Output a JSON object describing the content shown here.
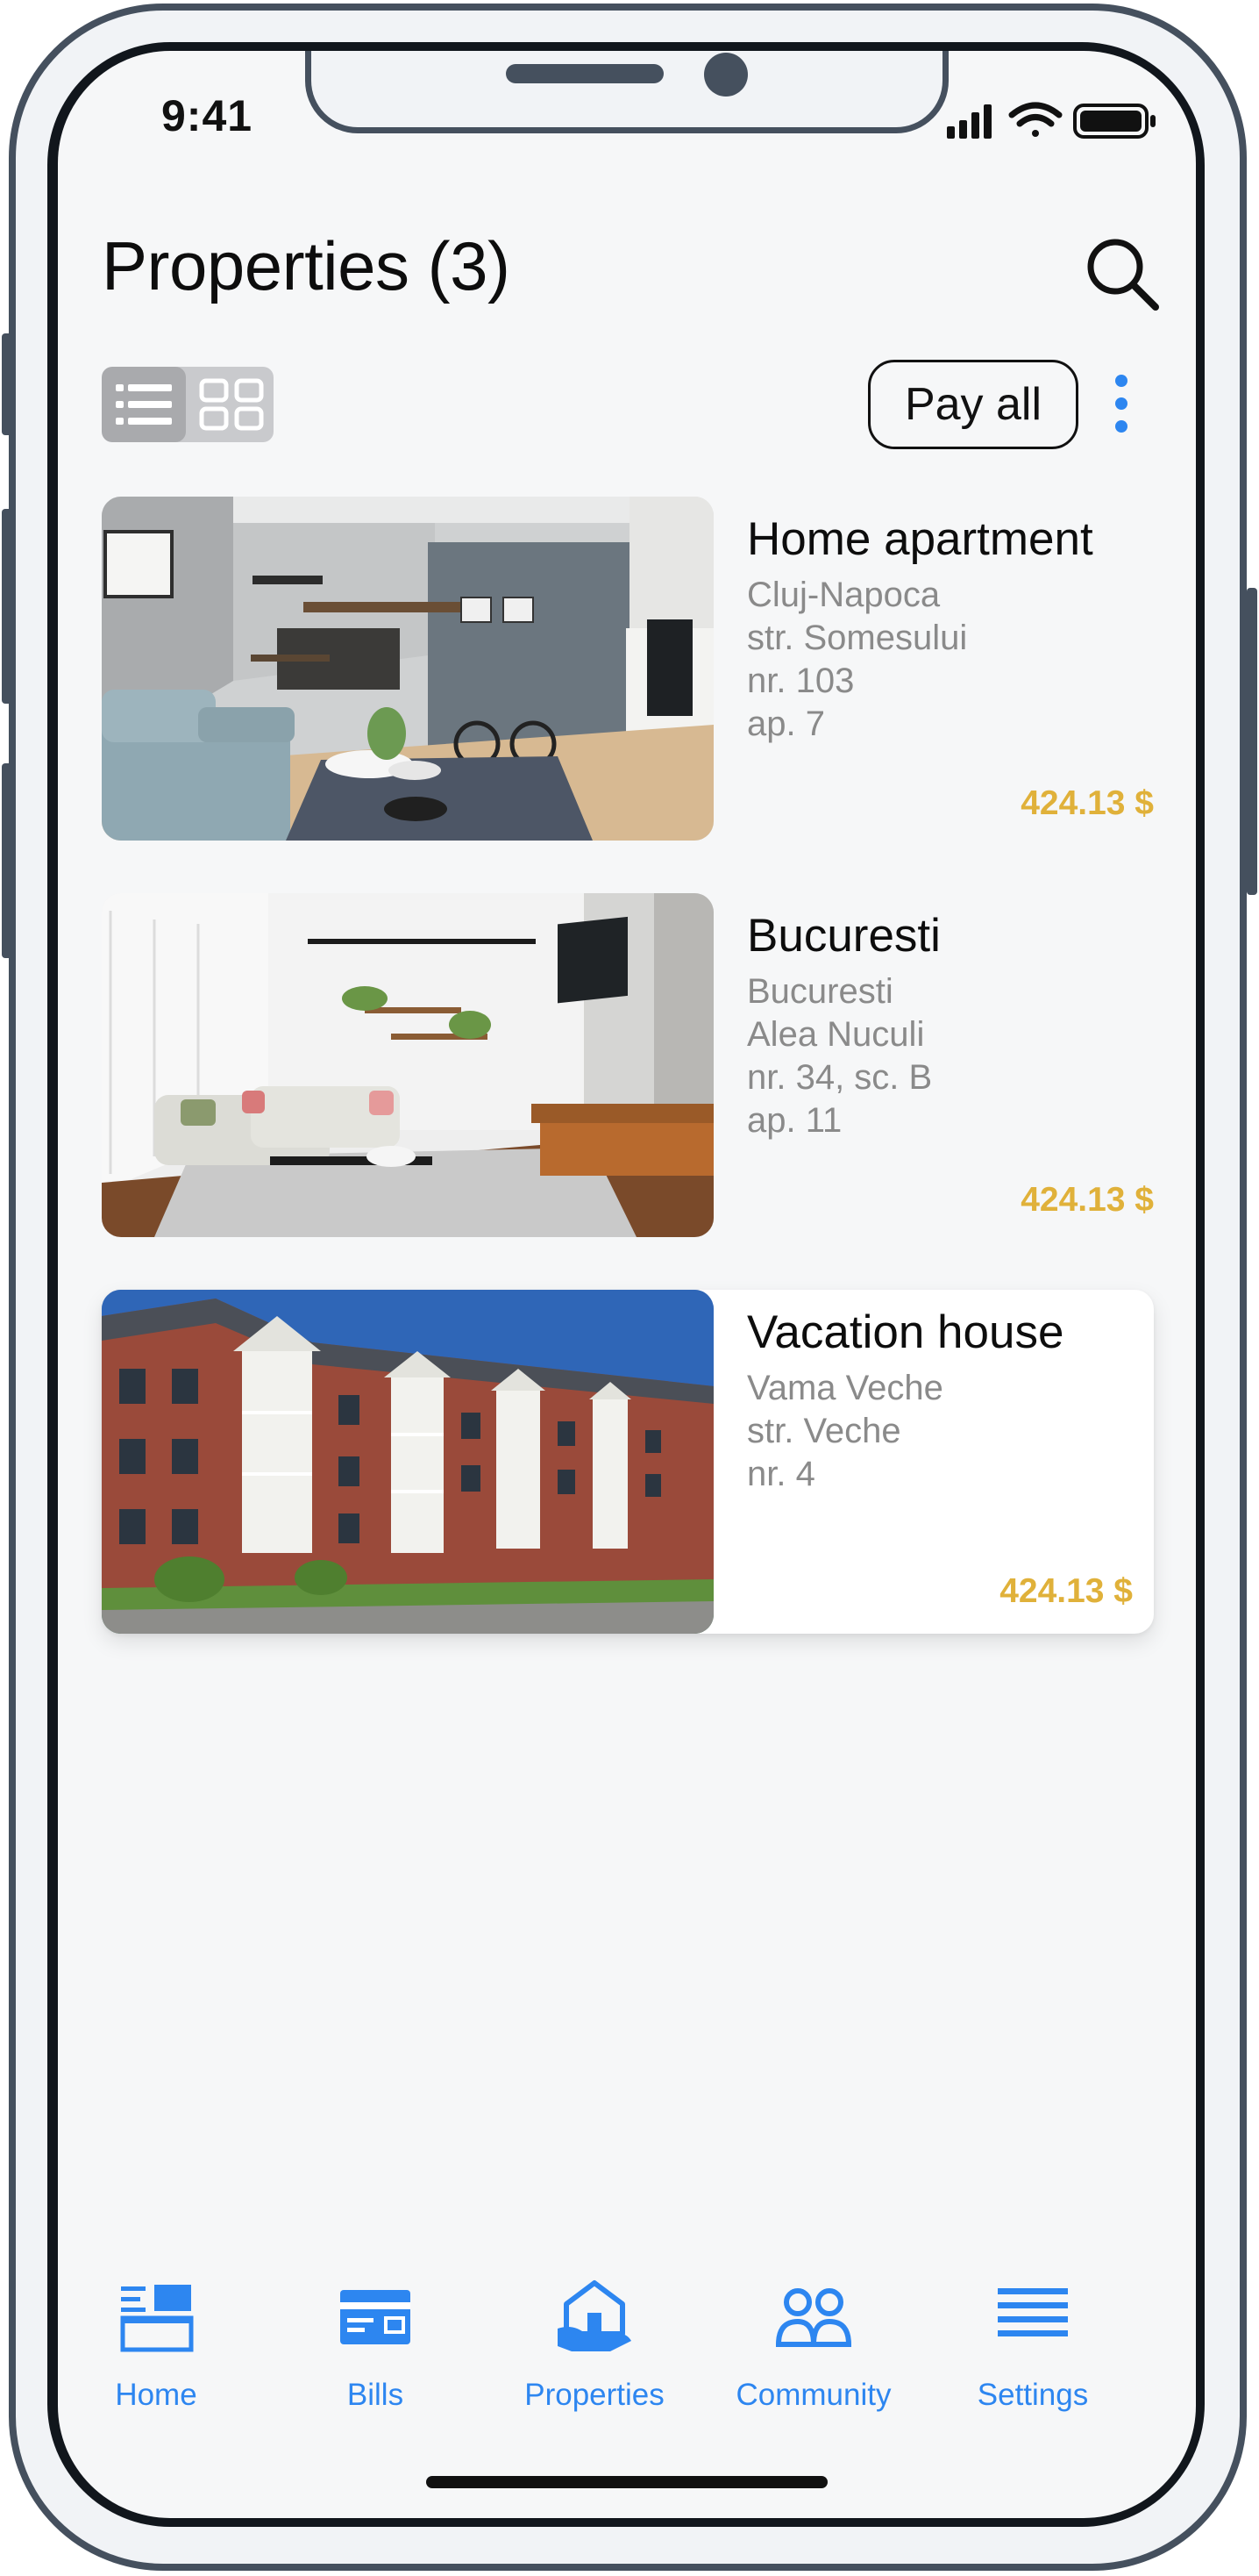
{
  "status_bar": {
    "time": "9:41"
  },
  "header": {
    "title": "Properties (3)"
  },
  "toolbar": {
    "pay_all_label": "Pay all"
  },
  "properties": [
    {
      "name": "Home apartment",
      "address": [
        "Cluj-Napoca",
        "str. Somesului",
        "nr. 103",
        "ap. 7"
      ],
      "price": "424.13 $",
      "highlighted": false
    },
    {
      "name": "Bucuresti",
      "address": [
        "Bucuresti",
        "Alea Nuculi",
        "nr. 34, sc. B",
        "ap. 11"
      ],
      "price": "424.13 $",
      "highlighted": false
    },
    {
      "name": "Vacation house",
      "address": [
        "Vama Veche",
        "str. Veche",
        "nr. 4"
      ],
      "price": "424.13 $",
      "highlighted": true
    }
  ],
  "tabbar": {
    "items": [
      {
        "label": "Home",
        "icon": "home-dashboard-icon"
      },
      {
        "label": "Bills",
        "icon": "bills-card-icon"
      },
      {
        "label": "Properties",
        "icon": "properties-house-icon"
      },
      {
        "label": "Community",
        "icon": "community-people-icon"
      },
      {
        "label": "Settings",
        "icon": "settings-lines-icon"
      }
    ],
    "active_color": "#2D86F0"
  },
  "colors": {
    "price": "#E0B13A",
    "frame": "#45505E",
    "screen_background": "#F6F7F8",
    "accent": "#2D86F0"
  }
}
